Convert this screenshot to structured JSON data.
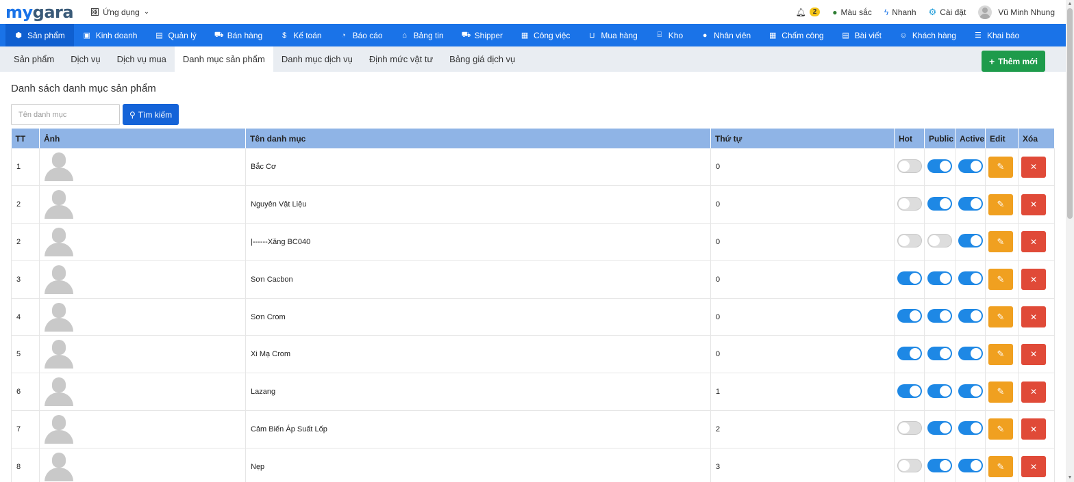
{
  "logo": {
    "my": "my",
    "gara": "gara"
  },
  "header": {
    "apps_label": "Ứng dụng",
    "notifications_count": "2",
    "color_label": "Màu sắc",
    "quick_label": "Nhanh",
    "settings_label": "Cài đặt",
    "user_name": "Vũ Minh Nhung"
  },
  "nav": [
    {
      "label": "Sản phẩm",
      "icon": "cube-icon",
      "glyph": "⬢"
    },
    {
      "label": "Kinh doanh",
      "icon": "bag-icon",
      "glyph": "▣"
    },
    {
      "label": "Quản lý",
      "icon": "id-card-icon",
      "glyph": "▤"
    },
    {
      "label": "Bán hàng",
      "icon": "cart-icon",
      "glyph": "⛟"
    },
    {
      "label": "Kế toán",
      "icon": "dollar-icon",
      "glyph": "$"
    },
    {
      "label": "Báo cáo",
      "icon": "pie-chart-icon",
      "glyph": "◔"
    },
    {
      "label": "Bảng tin",
      "icon": "home-icon",
      "glyph": "⌂"
    },
    {
      "label": "Shipper",
      "icon": "truck-icon",
      "glyph": "⛟"
    },
    {
      "label": "Công việc",
      "icon": "calendar-icon",
      "glyph": "▦"
    },
    {
      "label": "Mua hàng",
      "icon": "basket-icon",
      "glyph": "⊔"
    },
    {
      "label": "Kho",
      "icon": "warehouse-icon",
      "glyph": "⌸"
    },
    {
      "label": "Nhân viên",
      "icon": "user-icon",
      "glyph": "●"
    },
    {
      "label": "Chấm công",
      "icon": "calendar-check-icon",
      "glyph": "▦"
    },
    {
      "label": "Bài viết",
      "icon": "newspaper-icon",
      "glyph": "▤"
    },
    {
      "label": "Khách hàng",
      "icon": "smile-icon",
      "glyph": "☺"
    },
    {
      "label": "Khai báo",
      "icon": "list-icon",
      "glyph": "☰"
    }
  ],
  "subtabs": [
    "Sản phẩm",
    "Dịch vụ",
    "Dịch vụ mua",
    "Danh mục sản phẩm",
    "Danh mục dịch vụ",
    "Định mức vật tư",
    "Bảng giá dịch vụ"
  ],
  "add_button_label": "Thêm mới",
  "page_title": "Danh sách danh mục sản phẩm",
  "search": {
    "placeholder": "Tên danh mục",
    "value": "",
    "button_label": "Tìm kiếm"
  },
  "table": {
    "headers": [
      "TT",
      "Ảnh",
      "Tên danh mục",
      "Thứ tự",
      "Hot",
      "Public",
      "Active",
      "Edit",
      "Xóa"
    ],
    "rows": [
      {
        "tt": "1",
        "name": "Bắc Cơ",
        "order": "0",
        "hot": false,
        "public": true,
        "active": true
      },
      {
        "tt": "2",
        "name": "Nguyên Vật Liệu",
        "order": "0",
        "hot": false,
        "public": true,
        "active": true
      },
      {
        "tt": "2",
        "name": "|------Xăng BC040",
        "order": "0",
        "hot": false,
        "public": false,
        "active": true
      },
      {
        "tt": "3",
        "name": "Sơn Cacbon",
        "order": "0",
        "hot": true,
        "public": true,
        "active": true
      },
      {
        "tt": "4",
        "name": "Sơn Crom",
        "order": "0",
        "hot": true,
        "public": true,
        "active": true
      },
      {
        "tt": "5",
        "name": "Xi Mạ Crom",
        "order": "0",
        "hot": true,
        "public": true,
        "active": true
      },
      {
        "tt": "6",
        "name": "Lazang",
        "order": "1",
        "hot": true,
        "public": true,
        "active": true
      },
      {
        "tt": "7",
        "name": "Cảm Biến Áp Suất Lốp",
        "order": "2",
        "hot": false,
        "public": true,
        "active": true
      },
      {
        "tt": "8",
        "name": "Nẹp",
        "order": "3",
        "hot": false,
        "public": true,
        "active": true
      }
    ]
  },
  "colors": {
    "primary": "#1a73e8",
    "nav_active": "#0f5fd0",
    "table_header": "#8fb4e6",
    "add_green": "#1e9b4b",
    "edit_orange": "#f0a020",
    "delete_red": "#e04a38",
    "toggle_on": "#1e88e5"
  }
}
